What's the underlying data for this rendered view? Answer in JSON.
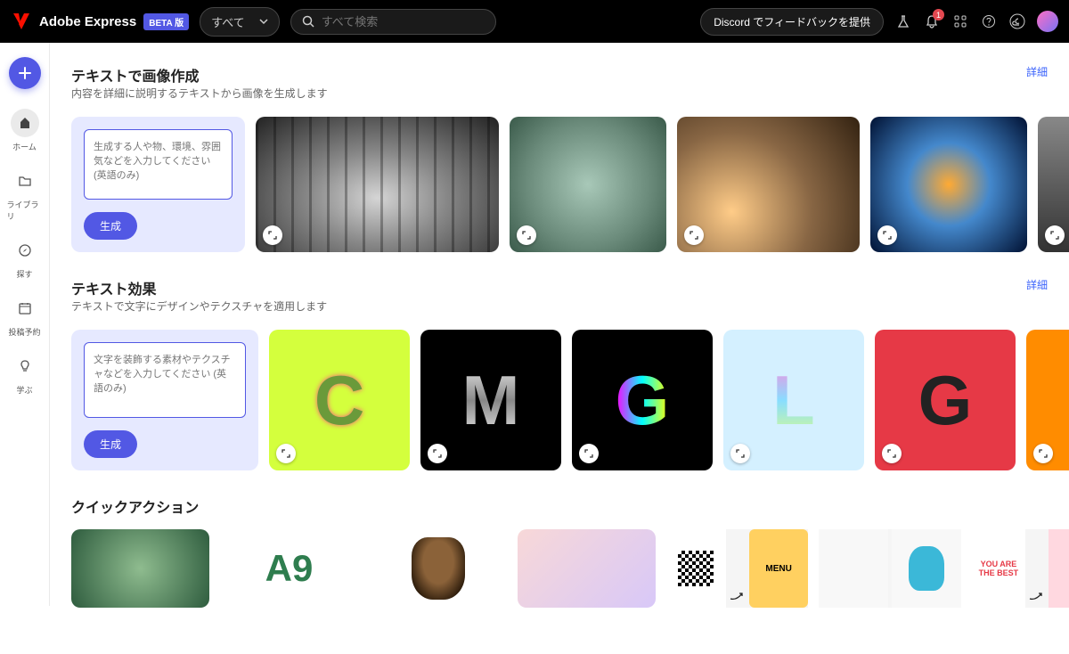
{
  "header": {
    "app_name": "Adobe Express",
    "beta_badge": "BETA 版",
    "filter_label": "すべて",
    "search_placeholder": "すべて検索",
    "discord_label": "Discord でフィードバックを提供",
    "notif_count": "1"
  },
  "sidebar": {
    "items": [
      {
        "label": "ホーム"
      },
      {
        "label": "ライブラリ"
      },
      {
        "label": "探す"
      },
      {
        "label": "投稿予約"
      },
      {
        "label": "学ぶ"
      }
    ]
  },
  "sections": {
    "text_to_image": {
      "title": "テキストで画像作成",
      "desc": "内容を詳細に説明するテキストから画像を生成します",
      "detail": "詳細",
      "prompt_placeholder": "生成する人や物、環境、雰囲気などを入力してください (英語のみ)",
      "generate": "生成",
      "thumbs": [
        "forest-sketch",
        "terrarium-jar",
        "ant-macro",
        "cosmic-orb",
        "rhino"
      ]
    },
    "text_effects": {
      "title": "テキスト効果",
      "desc": "テキストで文字にデザインやテクスチャを適用します",
      "detail": "詳細",
      "prompt_placeholder": "文字を装飾する素材やテクスチャなどを入力してください (英語のみ)",
      "generate": "生成",
      "thumbs": [
        "C-flowers",
        "M-chrome",
        "G-glitch",
        "L-holographic",
        "G-collage",
        "Y-orange"
      ]
    },
    "quick_actions": {
      "title": "クイックアクション",
      "thumbs": [
        "generate-image",
        "a9-leaf",
        "dog-bg-remove",
        "people-crop",
        "qr",
        "menu",
        "character",
        "you-best",
        "b-pink"
      ]
    }
  }
}
